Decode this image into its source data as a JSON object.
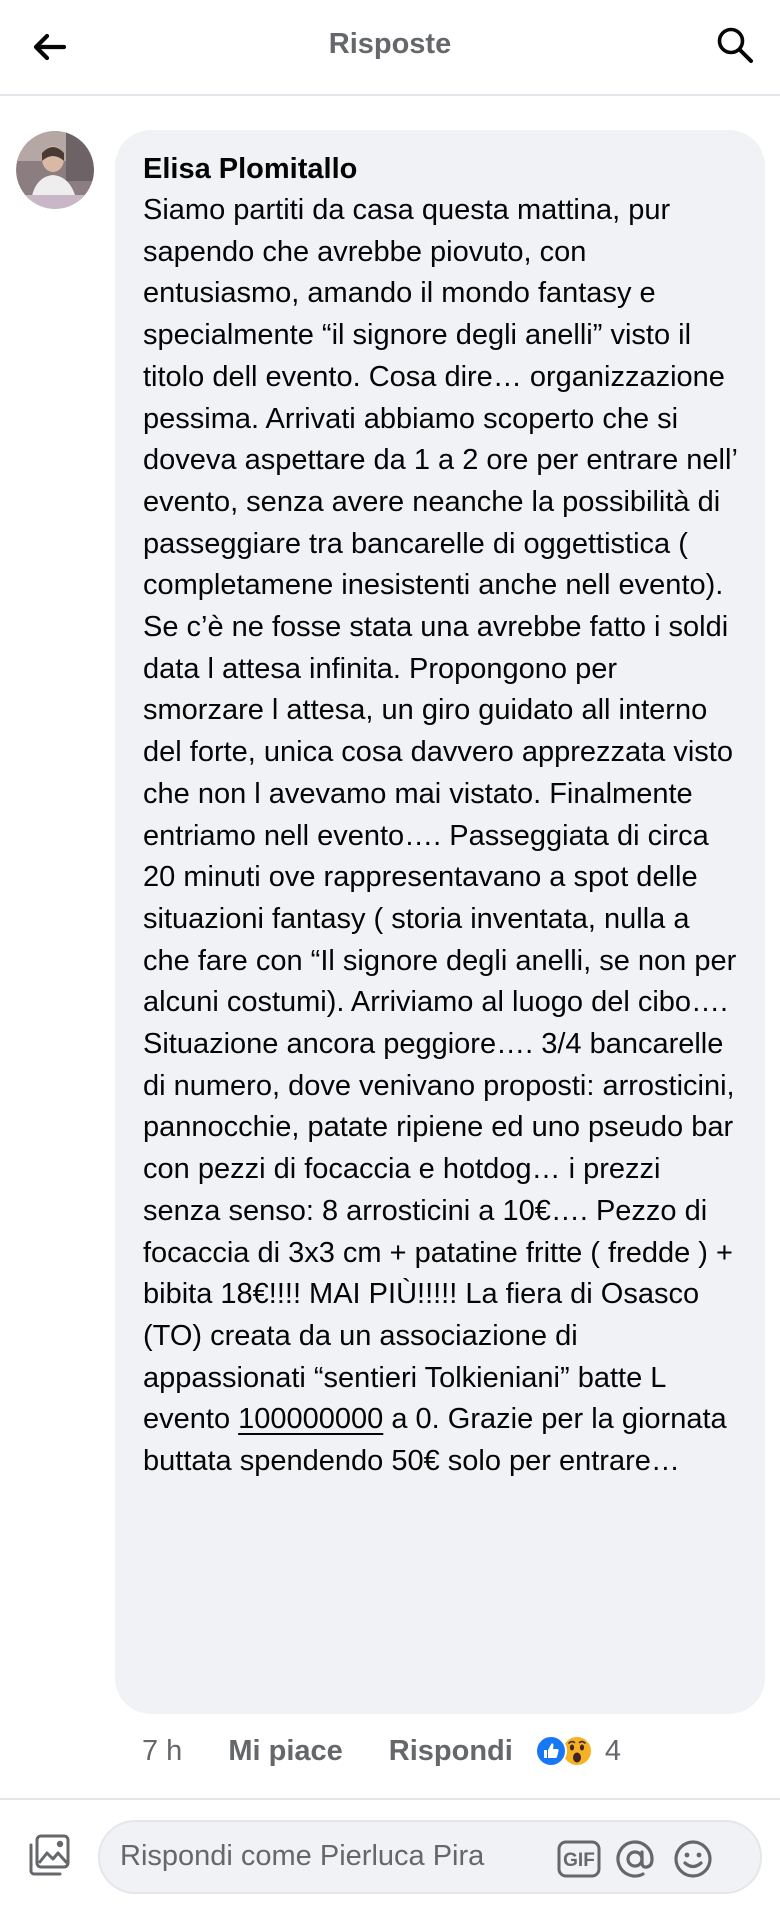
{
  "header": {
    "title": "Risposte"
  },
  "comment": {
    "author": "Elisa Plomitallo",
    "text_before_link": "Siamo partiti da casa questa mattina, pur sapendo che avrebbe piovuto, con entusiasmo, amando il mondo fantasy e specialmente “il signore degli anelli” visto il titolo dell evento. Cosa dire… organizzazione pessima. Arrivati abbiamo scoperto che si doveva aspettare da 1 a 2 ore per entrare nell’ evento, senza avere neanche la possibilità di passeggiare tra bancarelle di oggettistica ( completamene inesistenti anche nell evento). Se c’è ne fosse stata una avrebbe fatto i soldi data l attesa infinita. Propongono per smorzare l attesa, un giro guidato all interno del forte, unica cosa davvero apprezzata visto che non l avevamo mai vistato. Finalmente entriamo nell evento…. Passeggiata di circa 20 minuti ove rappresentavano a spot delle situazioni fantasy ( storia inventata, nulla a che fare con “Il signore degli anelli, se non per alcuni costumi). Arriviamo al luogo del cibo…. Situazione ancora peggiore…. 3/4 bancarelle di numero, dove venivano proposti: arrosticini, pannocchie, patate ripiene ed uno pseudo bar con pezzi di focaccia e hotdog… i prezzi senza senso: 8 arrosticini a 10€…. Pezzo di focaccia di 3x3 cm + patatine fritte ( fredde ) + bibita 18€!!!! MAI PIÙ!!!!! La fiera di Osasco (TO) creata da un associazione di appassionati “sentieri Tolkieniani” batte L evento ",
    "underlined_number": "100000000",
    "text_after_link": " a 0. Grazie per la giornata buttata spendendo 50€ solo per entrare…",
    "time": "7 h",
    "like_label": "Mi piace",
    "reply_label": "Rispondi",
    "reaction_count": "4",
    "reactions": [
      "like-icon",
      "wow-icon"
    ]
  },
  "composer": {
    "placeholder": "Rispondi come Pierluca Pira",
    "gif_label": "GIF"
  },
  "colors": {
    "like_blue": "#1877f2",
    "wow_yellow": "#f7b125",
    "secondary_text": "#65676b",
    "bubble_bg": "#f0f2f5"
  }
}
